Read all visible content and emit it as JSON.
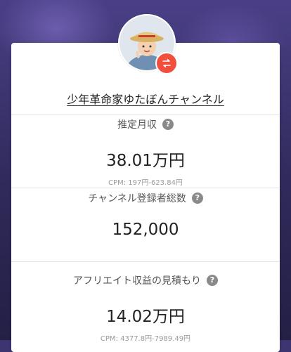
{
  "card": {
    "channel_name": "少年革命家ゆたぼんチャンネル",
    "avatar_icon": "avatar",
    "switch_icon": "switch-icon"
  },
  "sections": {
    "monthly": {
      "label": "推定月収",
      "value": "38.01万円",
      "cpm": "CPM: 197円-623.84円"
    },
    "subscribers": {
      "label": "チャンネル登録者総数",
      "value": "152,000"
    },
    "affiliate": {
      "label": "アフリエイト収益の見積もり",
      "value": "14.02万円",
      "cpm": "CPM: 4377.8円-7989.49円"
    },
    "help_glyph": "?"
  },
  "colors": {
    "accent": "#f24e3c",
    "help_icon": "#8a8a8a",
    "background": "#3c3570"
  }
}
